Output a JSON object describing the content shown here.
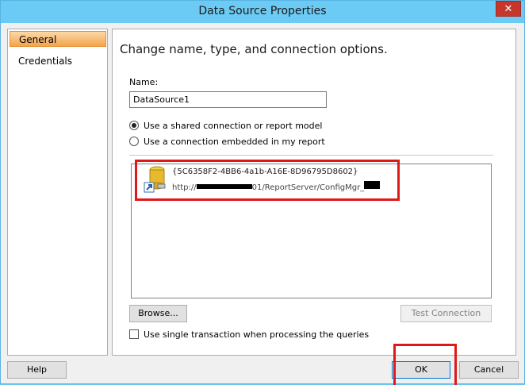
{
  "window": {
    "title": "Data Source Properties",
    "close_glyph": "✕"
  },
  "nav": {
    "items": [
      {
        "label": "General",
        "selected": true
      },
      {
        "label": "Credentials",
        "selected": false
      }
    ]
  },
  "general": {
    "heading": "Change name, type, and connection options.",
    "name_label": "Name:",
    "name_value": "DataSource1",
    "radio_shared": "Use a shared connection or report model",
    "radio_embedded": "Use a connection embedded in my report",
    "selected_radio": "shared",
    "shared_source": {
      "id": "{5C6358F2-4BB6-4a1b-A16E-8D96795D8602}",
      "path_prefix": "http://",
      "path_middle": "01/ReportServer/ConfigMgr_",
      "icon": "database-shortcut-icon"
    },
    "browse_label": "Browse...",
    "test_connection_label": "Test Connection",
    "single_transaction_label": "Use single transaction when processing the queries",
    "single_transaction_checked": false
  },
  "footer": {
    "help_label": "Help",
    "ok_label": "OK",
    "cancel_label": "Cancel"
  },
  "colors": {
    "titlebar": "#6ccbf4",
    "selected_nav": "#f3a34e",
    "highlight_annotation": "#e01818"
  }
}
